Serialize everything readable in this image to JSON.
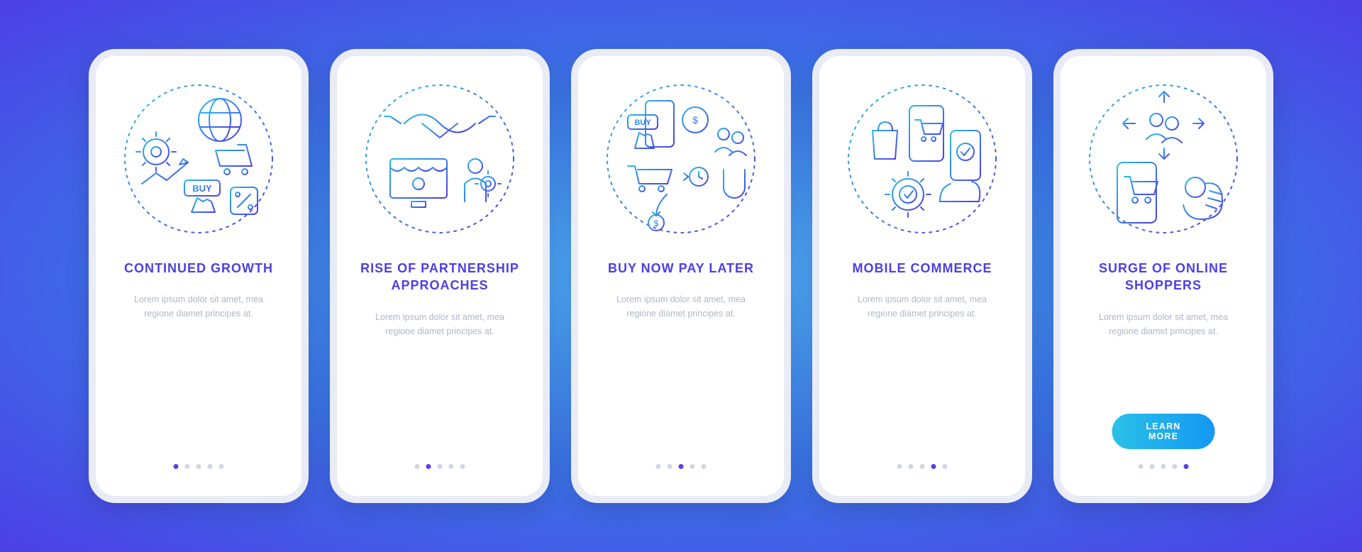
{
  "screens": [
    {
      "title": "CONTINUED GROWTH",
      "body": "Lorem ipsum dolor sit amet, mea regione diamet principes at.",
      "active_dot": 0,
      "show_button": false
    },
    {
      "title": "RISE OF PARTNERSHIP APPROACHES",
      "body": "Lorem ipsum dolor sit amet, mea regione diamet principes at.",
      "active_dot": 1,
      "show_button": false
    },
    {
      "title": "BUY NOW PAY LATER",
      "body": "Lorem ipsum dolor sit amet, mea regione diamet principes at.",
      "active_dot": 2,
      "show_button": false
    },
    {
      "title": "MOBILE COMMERCE",
      "body": "Lorem ipsum dolor sit amet, mea regione diamet principes at.",
      "active_dot": 3,
      "show_button": false
    },
    {
      "title": "SURGE OF ONLINE SHOPPERS",
      "body": "Lorem ipsum dolor sit amet, mea regione diamet principes at.",
      "active_dot": 4,
      "show_button": true
    }
  ],
  "button_label": "LEARN MORE",
  "dot_count": 5
}
